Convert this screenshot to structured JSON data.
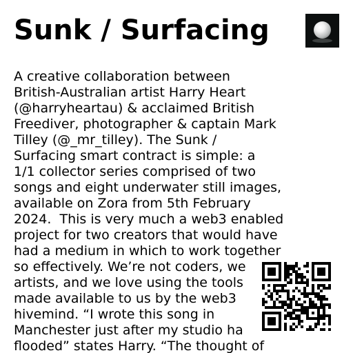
{
  "header": {
    "title": "Sunk / Surfacing",
    "thumbnail_icon": "pearl-orb-artwork-icon"
  },
  "description": {
    "lines": [
      "A creative collaboration between",
      "British-Australian artist Harry Heart",
      "(@harryheartau) & acclaimed British",
      "Freediver, photographer & captain Mark",
      "Tilley (@_mr_tilley). The Sunk /",
      "Surfacing smart contract is simple: a",
      "1/1 collector series comprised of two",
      "songs and eight underwater still images,",
      "available on Zora from 5th February",
      "2024.  This is very much a web3 enabled",
      "project for two creators that would have",
      "had a medium in which to work together",
      "so effectively. We’re not coders, we",
      "artists, and we love using the tools",
      "made available to us by the web3",
      "hivemind. “I wrote this song in",
      "Manchester just after my studio ha",
      "flooded” states Harry. “The thought of"
    ]
  },
  "qr": {
    "icon": "qr-code-icon"
  },
  "colors": {
    "background": "#ffffff",
    "text": "#000000",
    "thumbnail_bg": "#0c0f0f"
  }
}
